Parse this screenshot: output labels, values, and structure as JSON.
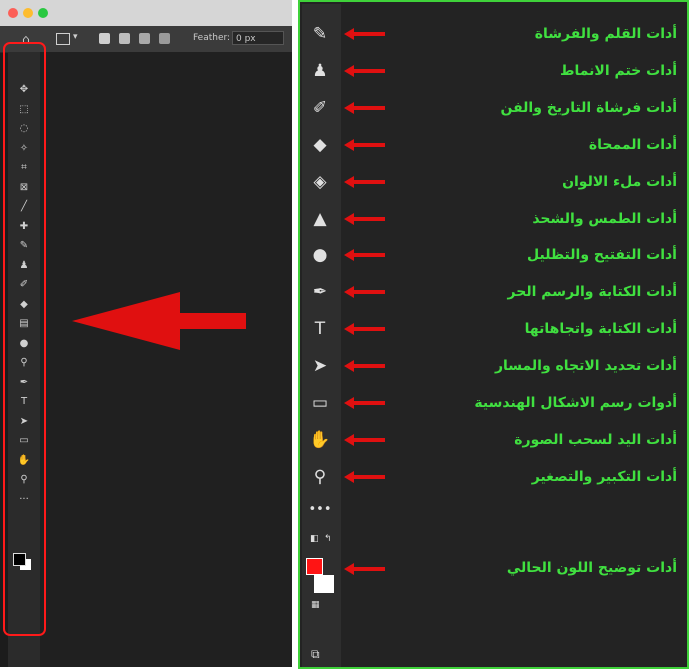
{
  "left_panel": {
    "options_bar": {
      "feather_label": "Feather:",
      "feather_value": "0 px"
    },
    "tools": [
      "move-icon",
      "marquee-icon",
      "lasso-icon",
      "quick-select-icon",
      "crop-icon",
      "frame-icon",
      "eyedropper-icon",
      "healing-icon",
      "brush-icon",
      "stamp-icon",
      "history-brush-icon",
      "eraser-icon",
      "gradient-icon",
      "blur-icon",
      "dodge-icon",
      "pen-icon",
      "type-icon",
      "path-select-icon",
      "rectangle-icon",
      "hand-icon",
      "zoom-icon",
      "more-icon"
    ]
  },
  "right_panel": {
    "items": [
      {
        "icon": "brush-icon",
        "glyph": "✎",
        "label": "أدات القلم والفرشاة"
      },
      {
        "icon": "stamp-icon",
        "glyph": "♟",
        "label": "أدات ختم الانماط"
      },
      {
        "icon": "history-brush-icon",
        "glyph": "✐",
        "label": "أدات فرشاة التاريخ والفن"
      },
      {
        "icon": "eraser-icon",
        "glyph": "◆",
        "label": "أدات الممحاة"
      },
      {
        "icon": "paint-bucket-icon",
        "glyph": "◈",
        "label": "أدات ملء الالوان"
      },
      {
        "icon": "blur-icon",
        "glyph": "▲",
        "label": "أدات الطمس والشحذ"
      },
      {
        "icon": "dodge-icon",
        "glyph": "●",
        "label": "أدات التفتيح والتظليل"
      },
      {
        "icon": "pen-icon",
        "glyph": "✒",
        "label": "أدات الكتابة والرسم الحر"
      },
      {
        "icon": "type-icon",
        "glyph": "T",
        "label": "أدات الكتابة واتجاهاتها"
      },
      {
        "icon": "path-select-icon",
        "glyph": "➤",
        "label": "أدات تحديد الاتجاه والمسار"
      },
      {
        "icon": "rectangle-icon",
        "glyph": "▭",
        "label": "أدوات رسم الاشكال الهندسية"
      },
      {
        "icon": "hand-icon",
        "glyph": "✋",
        "label": "أدات اليد لسحب الصورة"
      },
      {
        "icon": "zoom-icon",
        "glyph": "⚲",
        "label": "أدات التكبير والتصغير"
      }
    ],
    "more_glyph": "•••",
    "color_label": "أدات توضيح اللون الحالي"
  },
  "colors": {
    "label_green": "#40e040",
    "frame_green": "#3fd23a",
    "arrow_red": "#e01010",
    "foreground_swatch": "#ff1414",
    "background_swatch": "#ffffff"
  }
}
